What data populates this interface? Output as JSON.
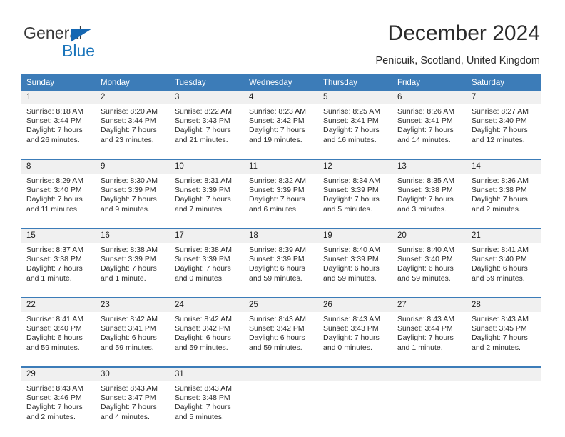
{
  "brand": {
    "name_top": "General",
    "name_bottom": "Blue",
    "accent_color": "#1b75bb",
    "triangle_icon": "triangle-icon"
  },
  "header": {
    "title": "December 2024",
    "subtitle": "Penicuik, Scotland, United Kingdom"
  },
  "calendar": {
    "header_bg": "#3c7cb8",
    "daynum_bg": "#f0f0f0",
    "weekdays": [
      "Sunday",
      "Monday",
      "Tuesday",
      "Wednesday",
      "Thursday",
      "Friday",
      "Saturday"
    ],
    "weeks": [
      [
        {
          "day": "1",
          "sunrise": "Sunrise: 8:18 AM",
          "sunset": "Sunset: 3:44 PM",
          "daylight1": "Daylight: 7 hours",
          "daylight2": "and 26 minutes."
        },
        {
          "day": "2",
          "sunrise": "Sunrise: 8:20 AM",
          "sunset": "Sunset: 3:44 PM",
          "daylight1": "Daylight: 7 hours",
          "daylight2": "and 23 minutes."
        },
        {
          "day": "3",
          "sunrise": "Sunrise: 8:22 AM",
          "sunset": "Sunset: 3:43 PM",
          "daylight1": "Daylight: 7 hours",
          "daylight2": "and 21 minutes."
        },
        {
          "day": "4",
          "sunrise": "Sunrise: 8:23 AM",
          "sunset": "Sunset: 3:42 PM",
          "daylight1": "Daylight: 7 hours",
          "daylight2": "and 19 minutes."
        },
        {
          "day": "5",
          "sunrise": "Sunrise: 8:25 AM",
          "sunset": "Sunset: 3:41 PM",
          "daylight1": "Daylight: 7 hours",
          "daylight2": "and 16 minutes."
        },
        {
          "day": "6",
          "sunrise": "Sunrise: 8:26 AM",
          "sunset": "Sunset: 3:41 PM",
          "daylight1": "Daylight: 7 hours",
          "daylight2": "and 14 minutes."
        },
        {
          "day": "7",
          "sunrise": "Sunrise: 8:27 AM",
          "sunset": "Sunset: 3:40 PM",
          "daylight1": "Daylight: 7 hours",
          "daylight2": "and 12 minutes."
        }
      ],
      [
        {
          "day": "8",
          "sunrise": "Sunrise: 8:29 AM",
          "sunset": "Sunset: 3:40 PM",
          "daylight1": "Daylight: 7 hours",
          "daylight2": "and 11 minutes."
        },
        {
          "day": "9",
          "sunrise": "Sunrise: 8:30 AM",
          "sunset": "Sunset: 3:39 PM",
          "daylight1": "Daylight: 7 hours",
          "daylight2": "and 9 minutes."
        },
        {
          "day": "10",
          "sunrise": "Sunrise: 8:31 AM",
          "sunset": "Sunset: 3:39 PM",
          "daylight1": "Daylight: 7 hours",
          "daylight2": "and 7 minutes."
        },
        {
          "day": "11",
          "sunrise": "Sunrise: 8:32 AM",
          "sunset": "Sunset: 3:39 PM",
          "daylight1": "Daylight: 7 hours",
          "daylight2": "and 6 minutes."
        },
        {
          "day": "12",
          "sunrise": "Sunrise: 8:34 AM",
          "sunset": "Sunset: 3:39 PM",
          "daylight1": "Daylight: 7 hours",
          "daylight2": "and 5 minutes."
        },
        {
          "day": "13",
          "sunrise": "Sunrise: 8:35 AM",
          "sunset": "Sunset: 3:38 PM",
          "daylight1": "Daylight: 7 hours",
          "daylight2": "and 3 minutes."
        },
        {
          "day": "14",
          "sunrise": "Sunrise: 8:36 AM",
          "sunset": "Sunset: 3:38 PM",
          "daylight1": "Daylight: 7 hours",
          "daylight2": "and 2 minutes."
        }
      ],
      [
        {
          "day": "15",
          "sunrise": "Sunrise: 8:37 AM",
          "sunset": "Sunset: 3:38 PM",
          "daylight1": "Daylight: 7 hours",
          "daylight2": "and 1 minute."
        },
        {
          "day": "16",
          "sunrise": "Sunrise: 8:38 AM",
          "sunset": "Sunset: 3:39 PM",
          "daylight1": "Daylight: 7 hours",
          "daylight2": "and 1 minute."
        },
        {
          "day": "17",
          "sunrise": "Sunrise: 8:38 AM",
          "sunset": "Sunset: 3:39 PM",
          "daylight1": "Daylight: 7 hours",
          "daylight2": "and 0 minutes."
        },
        {
          "day": "18",
          "sunrise": "Sunrise: 8:39 AM",
          "sunset": "Sunset: 3:39 PM",
          "daylight1": "Daylight: 6 hours",
          "daylight2": "and 59 minutes."
        },
        {
          "day": "19",
          "sunrise": "Sunrise: 8:40 AM",
          "sunset": "Sunset: 3:39 PM",
          "daylight1": "Daylight: 6 hours",
          "daylight2": "and 59 minutes."
        },
        {
          "day": "20",
          "sunrise": "Sunrise: 8:40 AM",
          "sunset": "Sunset: 3:40 PM",
          "daylight1": "Daylight: 6 hours",
          "daylight2": "and 59 minutes."
        },
        {
          "day": "21",
          "sunrise": "Sunrise: 8:41 AM",
          "sunset": "Sunset: 3:40 PM",
          "daylight1": "Daylight: 6 hours",
          "daylight2": "and 59 minutes."
        }
      ],
      [
        {
          "day": "22",
          "sunrise": "Sunrise: 8:41 AM",
          "sunset": "Sunset: 3:40 PM",
          "daylight1": "Daylight: 6 hours",
          "daylight2": "and 59 minutes."
        },
        {
          "day": "23",
          "sunrise": "Sunrise: 8:42 AM",
          "sunset": "Sunset: 3:41 PM",
          "daylight1": "Daylight: 6 hours",
          "daylight2": "and 59 minutes."
        },
        {
          "day": "24",
          "sunrise": "Sunrise: 8:42 AM",
          "sunset": "Sunset: 3:42 PM",
          "daylight1": "Daylight: 6 hours",
          "daylight2": "and 59 minutes."
        },
        {
          "day": "25",
          "sunrise": "Sunrise: 8:43 AM",
          "sunset": "Sunset: 3:42 PM",
          "daylight1": "Daylight: 6 hours",
          "daylight2": "and 59 minutes."
        },
        {
          "day": "26",
          "sunrise": "Sunrise: 8:43 AM",
          "sunset": "Sunset: 3:43 PM",
          "daylight1": "Daylight: 7 hours",
          "daylight2": "and 0 minutes."
        },
        {
          "day": "27",
          "sunrise": "Sunrise: 8:43 AM",
          "sunset": "Sunset: 3:44 PM",
          "daylight1": "Daylight: 7 hours",
          "daylight2": "and 1 minute."
        },
        {
          "day": "28",
          "sunrise": "Sunrise: 8:43 AM",
          "sunset": "Sunset: 3:45 PM",
          "daylight1": "Daylight: 7 hours",
          "daylight2": "and 2 minutes."
        }
      ],
      [
        {
          "day": "29",
          "sunrise": "Sunrise: 8:43 AM",
          "sunset": "Sunset: 3:46 PM",
          "daylight1": "Daylight: 7 hours",
          "daylight2": "and 2 minutes."
        },
        {
          "day": "30",
          "sunrise": "Sunrise: 8:43 AM",
          "sunset": "Sunset: 3:47 PM",
          "daylight1": "Daylight: 7 hours",
          "daylight2": "and 4 minutes."
        },
        {
          "day": "31",
          "sunrise": "Sunrise: 8:43 AM",
          "sunset": "Sunset: 3:48 PM",
          "daylight1": "Daylight: 7 hours",
          "daylight2": "and 5 minutes."
        },
        {
          "day": "",
          "sunrise": "",
          "sunset": "",
          "daylight1": "",
          "daylight2": ""
        },
        {
          "day": "",
          "sunrise": "",
          "sunset": "",
          "daylight1": "",
          "daylight2": ""
        },
        {
          "day": "",
          "sunrise": "",
          "sunset": "",
          "daylight1": "",
          "daylight2": ""
        },
        {
          "day": "",
          "sunrise": "",
          "sunset": "",
          "daylight1": "",
          "daylight2": ""
        }
      ]
    ]
  }
}
